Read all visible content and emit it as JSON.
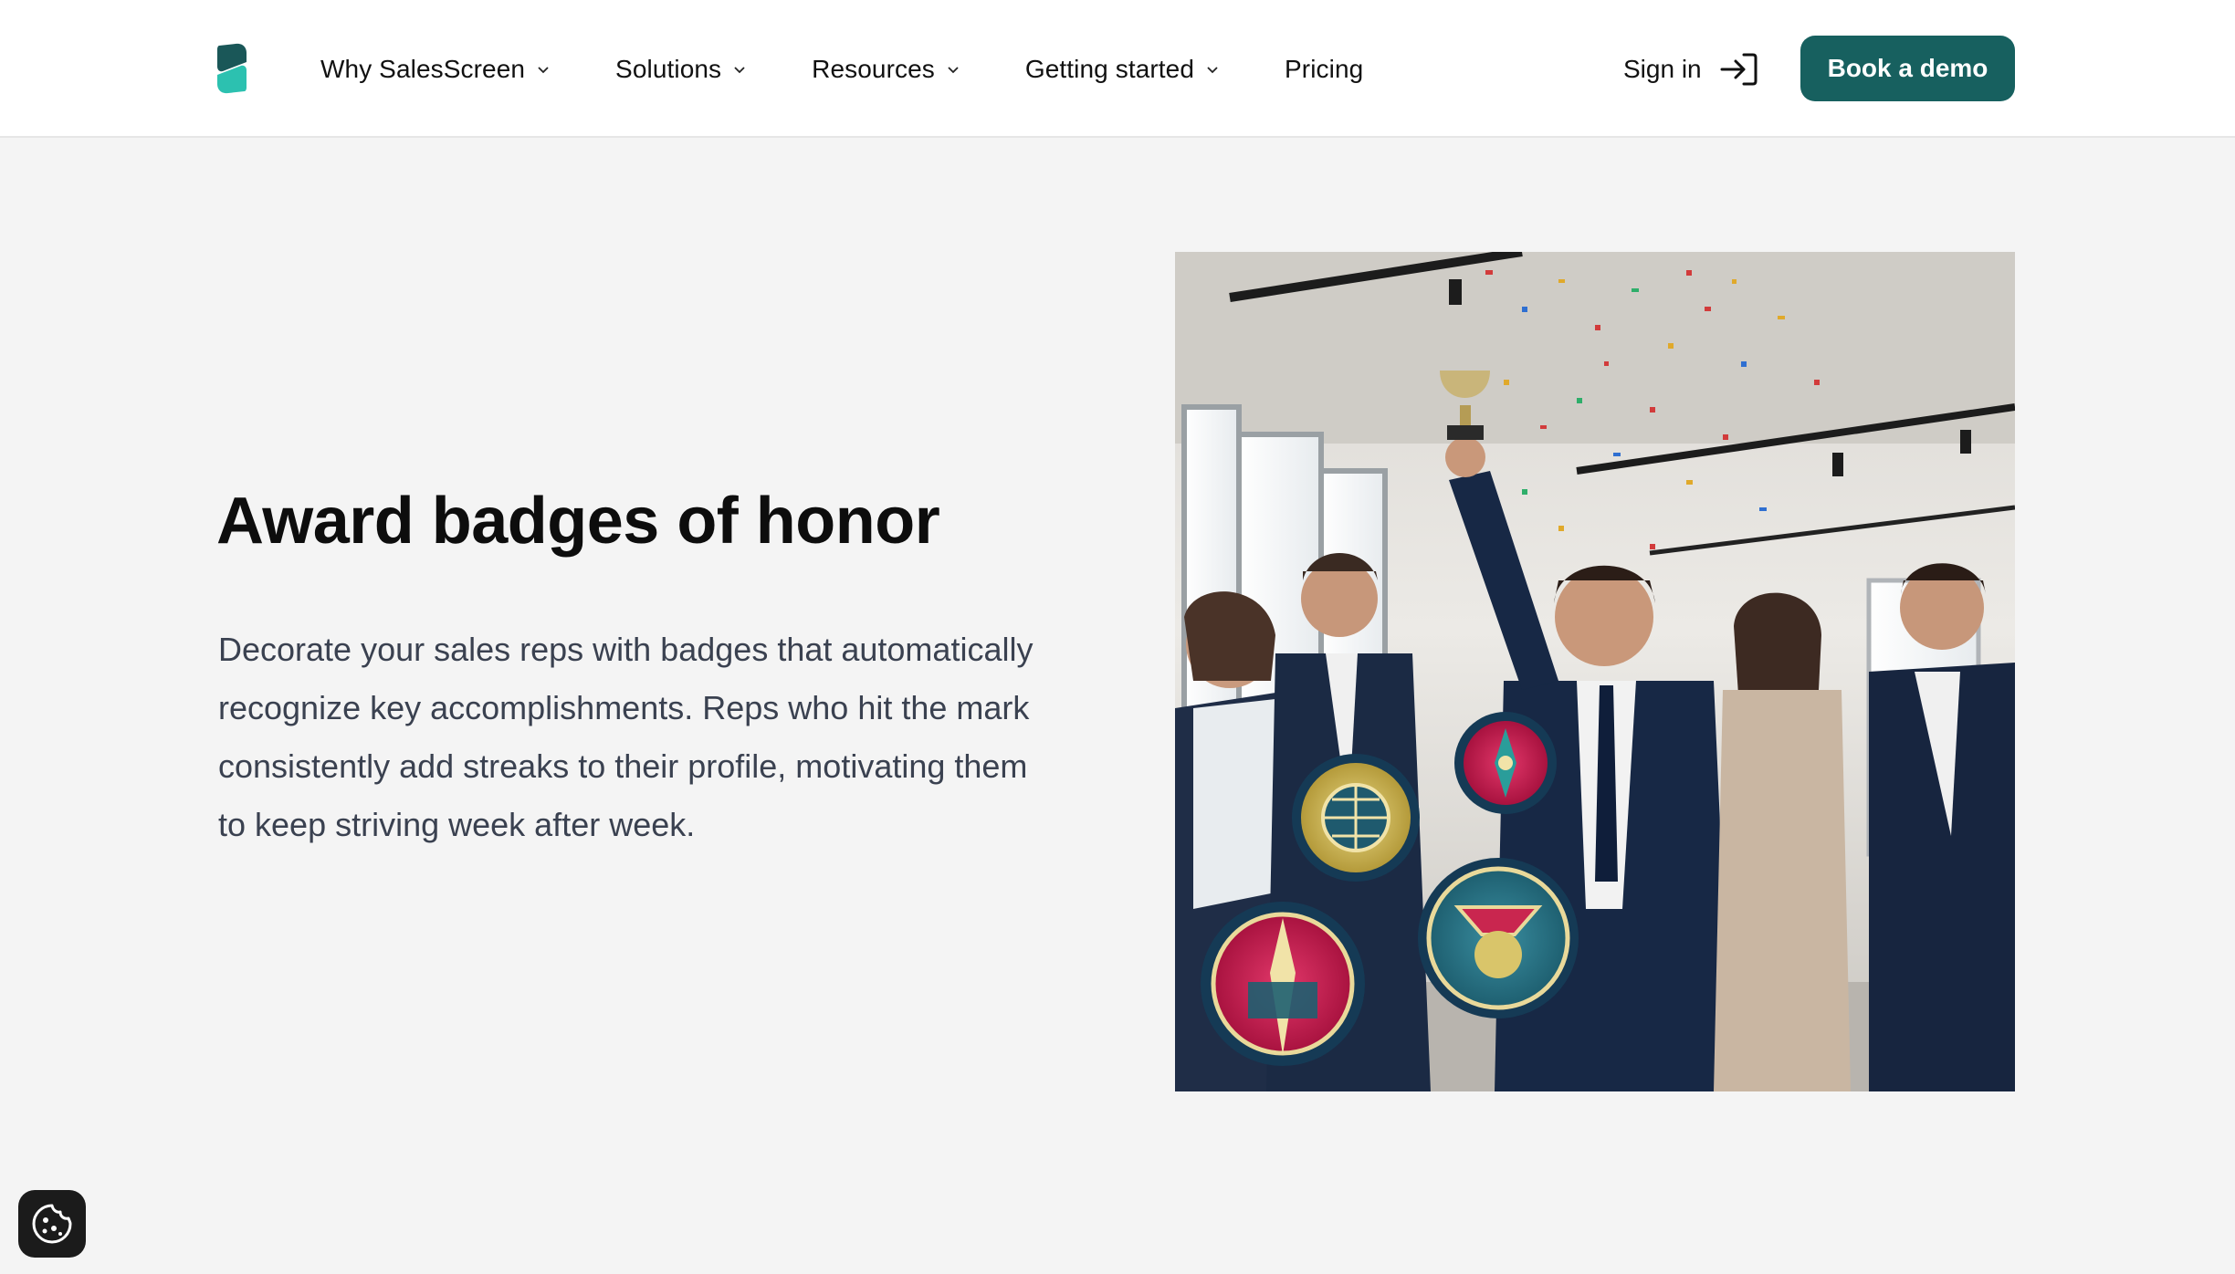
{
  "header": {
    "logo_icon": "salesscreen-logo",
    "nav": [
      {
        "label": "Why SalesScreen",
        "has_dropdown": true
      },
      {
        "label": "Solutions",
        "has_dropdown": true
      },
      {
        "label": "Resources",
        "has_dropdown": true
      },
      {
        "label": "Getting started",
        "has_dropdown": true
      },
      {
        "label": "Pricing",
        "has_dropdown": false
      }
    ],
    "signin_label": "Sign in",
    "signin_icon": "sign-in-arrow-icon",
    "demo_label": "Book a demo"
  },
  "main": {
    "heading": "Award badges of honor",
    "paragraph": "Decorate your sales reps with badges that automatically recognize key accomplishments. Reps who hit the mark consistently add streaks to their profile, motivating them to keep striving week after week.",
    "image_alt": "Team celebrating with a trophy, confetti and achievement badges"
  },
  "cookie": {
    "icon": "cookie-icon"
  },
  "colors": {
    "brand_teal": "#17605f",
    "page_bg": "#f4f4f4",
    "text_body": "#3a4150"
  }
}
